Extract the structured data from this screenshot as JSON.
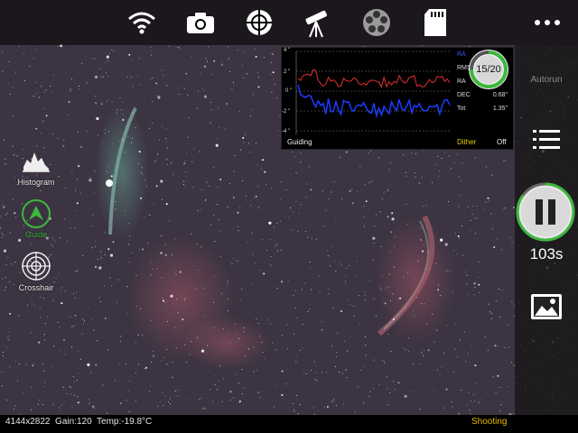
{
  "toolbar": {
    "icons": [
      "wifi-icon",
      "camera-icon",
      "crosshair-target-icon",
      "telescope-icon",
      "filter-wheel-icon",
      "sd-card-icon"
    ],
    "more": "more-dots-icon"
  },
  "right_panel": {
    "autorun_label": "Autorun",
    "timer": "103s",
    "capture_progress": 0.85
  },
  "left_panel": {
    "histogram_label": "Histogram",
    "guide_label": "Guide",
    "crosshair_label": "Crosshair"
  },
  "guide_graph": {
    "y_ticks": [
      "4 \"",
      "2 \"",
      "0 \"",
      "-2 \"",
      "-4 \""
    ],
    "legend": {
      "ra_blue": "RA",
      "rms_label": "RMS",
      "ra_label": "RA",
      "ra_value": "",
      "dec_label": "DEC",
      "dec_value": "0.68\"",
      "tot_label": "Tot",
      "tot_value": "1.35\""
    },
    "counter": "15/20",
    "counter_progress": 0.75,
    "guiding_label": "Guiding",
    "dither_label": "Dither",
    "dither_value": "Off",
    "colors": {
      "ra": "#e03030",
      "dec": "#1a3cff",
      "accent": "#3db83d"
    }
  },
  "status_bar": {
    "info": "4144x2822  Gain:120  Temp:-19.8°C",
    "status": "Shooting"
  }
}
